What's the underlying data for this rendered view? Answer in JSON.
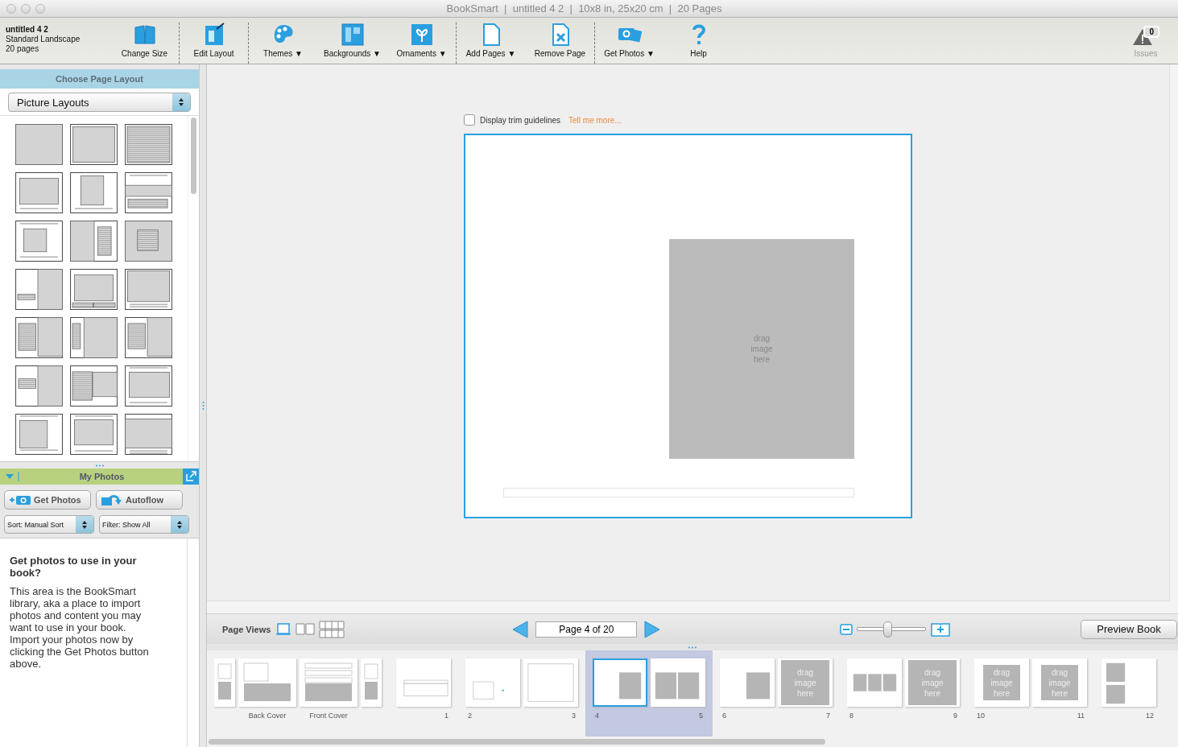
{
  "window": {
    "title": "BookSmart  |  untitled 4 2  |  10x8 in, 25x20 cm  |  20 Pages"
  },
  "book": {
    "name": "untitled 4 2",
    "format": "Standard Landscape",
    "pages": "20 pages"
  },
  "toolbar": [
    {
      "label": "Change Size",
      "kind": "book",
      "separator_before": false
    },
    {
      "label": "Edit Layout",
      "kind": "edit",
      "separator_before": true
    },
    {
      "label": "Themes ▼",
      "kind": "palette",
      "separator_before": true
    },
    {
      "label": "Backgrounds ▼",
      "kind": "backgrounds",
      "separator_before": false
    },
    {
      "label": "Ornaments ▼",
      "kind": "ornaments",
      "separator_before": false
    },
    {
      "label": "Add Pages ▼",
      "kind": "add-page",
      "separator_before": true
    },
    {
      "label": "Remove Page",
      "kind": "remove-page",
      "separator_before": false
    },
    {
      "label": "Get Photos ▼",
      "kind": "camera",
      "separator_before": true
    },
    {
      "label": "Help",
      "kind": "help",
      "separator_before": false
    }
  ],
  "issues": {
    "count": "0",
    "label": "Issues"
  },
  "layout_panel": {
    "title": "Choose Page Layout",
    "dropdown": "Picture Layouts"
  },
  "photos_panel": {
    "title": "My Photos",
    "expanded": true,
    "buttons": [
      {
        "label": "Get Photos",
        "kind": "camera"
      },
      {
        "label": "Autoflow",
        "kind": "autoflow"
      }
    ],
    "sort": "Sort:  Manual Sort",
    "filter": "Filter: Show All",
    "help_title": "Get photos to use in your book?",
    "help_text": "This area is the BookSmart library, aka a place to import photos and content you may want to use in your book. Import your photos now by clicking the Get Photos button above."
  },
  "canvas": {
    "trim_checkbox": {
      "label": "Display trim guidelines",
      "checked": false
    },
    "link": "Tell me more...",
    "photo_placeholder": "drag image here"
  },
  "bottom_bar": {
    "page_views_label": "Page Views",
    "view_modes": [
      {
        "kind": "single",
        "selected": true
      },
      {
        "kind": "spread",
        "selected": false
      },
      {
        "kind": "grid",
        "selected": false
      }
    ],
    "page_field": "Page 4 of 20",
    "zoom": {
      "level": 0.44
    },
    "preview_button": "Preview Book"
  },
  "filmstrip": [
    {
      "selected": false,
      "pages": [
        {
          "kind": "spine",
          "current": false
        },
        {
          "kind": "back-cover",
          "label": "Back Cover",
          "current": false
        },
        {
          "kind": "front-cover",
          "label": "Front Cover",
          "current": false
        },
        {
          "kind": "spine",
          "current": false
        }
      ]
    },
    {
      "selected": false,
      "pages": [
        {
          "kind": "text-box",
          "label": "1",
          "current": false
        }
      ]
    },
    {
      "selected": false,
      "pages": [
        {
          "kind": "small-box",
          "label": "2",
          "current": false
        },
        {
          "kind": "framed",
          "label": "3",
          "current": false
        }
      ]
    },
    {
      "selected": true,
      "pages": [
        {
          "kind": "photo-right",
          "label": "4",
          "current": true
        },
        {
          "kind": "two-photos",
          "label": "5",
          "current": false
        }
      ]
    },
    {
      "selected": false,
      "pages": [
        {
          "kind": "photo-center",
          "label": "6",
          "current": false
        },
        {
          "kind": "drag-full",
          "label": "7",
          "placeholder": "drag image here",
          "current": false
        }
      ]
    },
    {
      "selected": false,
      "pages": [
        {
          "kind": "three-photos",
          "label": "8",
          "current": false
        },
        {
          "kind": "drag-full",
          "label": "9",
          "placeholder": "drag image here",
          "current": false
        }
      ]
    },
    {
      "selected": false,
      "pages": [
        {
          "kind": "drag-inset",
          "label": "10",
          "placeholder": "drag image here",
          "current": false
        },
        {
          "kind": "drag-inset",
          "label": "11",
          "placeholder": "drag image here",
          "current": false
        }
      ]
    },
    {
      "selected": false,
      "pages": [
        {
          "kind": "two-stacked",
          "label": "12",
          "current": false
        }
      ]
    }
  ]
}
